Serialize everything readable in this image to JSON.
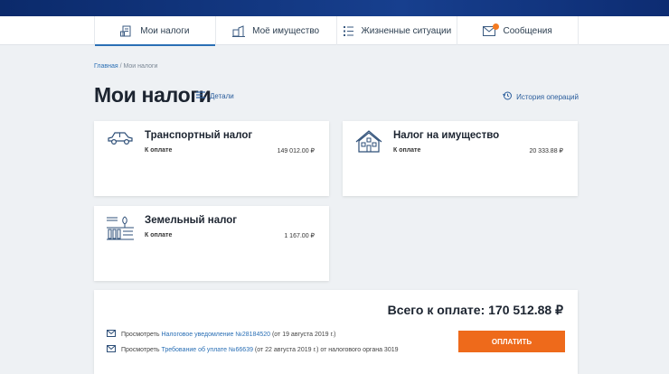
{
  "nav": {
    "items": [
      {
        "label": "Мои налоги"
      },
      {
        "label": "Моё имущество"
      },
      {
        "label": "Жизненные ситуации"
      },
      {
        "label": "Сообщения"
      }
    ]
  },
  "breadcrumb": {
    "home": "Главная",
    "separator": " / ",
    "current": "Мои налоги"
  },
  "page": {
    "title": "Мои налоги",
    "details_label": "Детали",
    "history_label": "История операций"
  },
  "cards": {
    "transport": {
      "title": "Транспортный налог",
      "label": "К оплате",
      "amount": "149 012.00 ₽",
      "icon": "car-icon"
    },
    "property": {
      "title": "Налог на имущество",
      "label": "К оплате",
      "amount": "20 333.88 ₽",
      "icon": "house-icon"
    },
    "land": {
      "title": "Земельный налог",
      "label": "К оплате",
      "amount": "1 167.00 ₽",
      "icon": "land-icon"
    }
  },
  "summary": {
    "total": "Всего к оплате: 170 512.88  ₽",
    "notice": {
      "prefix": "Просмотреть ",
      "link": "Налоговое уведомление №28184520",
      "suffix": " (от 19 августа 2019 г.)"
    },
    "demand": {
      "prefix": "Просмотреть ",
      "link": "Требование об уплате №66639",
      "suffix": "  (от 22 августа 2019 г.) от налогового органа 3019"
    },
    "pay_label": "ОПЛАТИТЬ"
  },
  "colors": {
    "accent": "#2a6fb5",
    "pay": "#ee6a1b",
    "header": "#0b2a6b",
    "badge": "#f47a21"
  }
}
